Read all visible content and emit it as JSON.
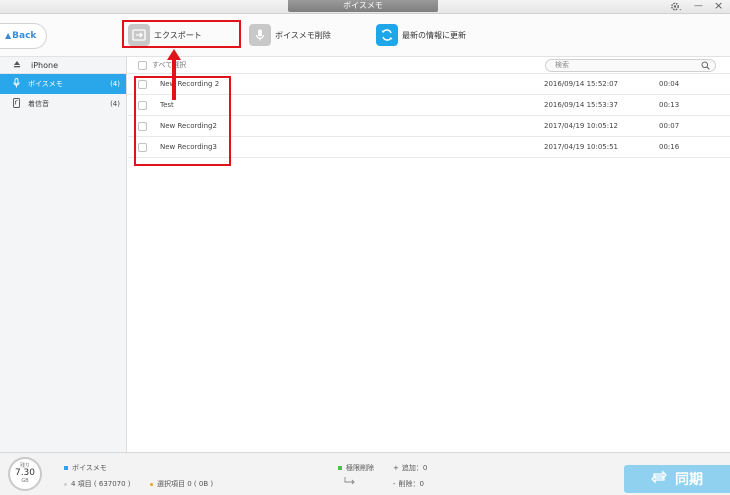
{
  "window": {
    "title": "ボイスメモ",
    "settings_icon": "gear-icon",
    "minimize": "—",
    "close": "×"
  },
  "toolbar": {
    "back_label": "Back",
    "export_label": "エクスポート",
    "delete_label": "ボイスメモ削除",
    "refresh_label": "最新の情報に更新"
  },
  "sidebar": {
    "device": "iPhone",
    "items": [
      {
        "label": "ボイスメモ",
        "count": "(4)",
        "icon": "microphone-icon"
      },
      {
        "label": "着信音",
        "count": "(4)",
        "icon": "phone-icon"
      }
    ]
  },
  "list": {
    "select_all": "すべて選択",
    "search_placeholder": "検索",
    "rows": [
      {
        "name": "New Recording 2",
        "date": "2016/09/14 15:52:07",
        "duration": "00:04"
      },
      {
        "name": "Test",
        "date": "2016/09/14 15:53:37",
        "duration": "00:13"
      },
      {
        "name": "New Recording2",
        "date": "2017/04/19 10:05:12",
        "duration": "00:07"
      },
      {
        "name": "New Recording3",
        "date": "2017/04/19 10:05:51",
        "duration": "00:16"
      }
    ]
  },
  "footer": {
    "storage_label": "残り",
    "storage_value": "7.30",
    "storage_unit": "GB",
    "category_label": "ボイスメモ",
    "items_count": "4 項目 ( 637070 )",
    "selected_count": "選択項目 0 ( 0B )",
    "perm_delete_label": "極限削除",
    "add_label": "追加：0",
    "delete_label": "削除：0",
    "sync_label": "同期"
  },
  "colors": {
    "accent": "#29a7ea",
    "highlight": "#e0131b",
    "sync_button": "#8fd1ef"
  }
}
